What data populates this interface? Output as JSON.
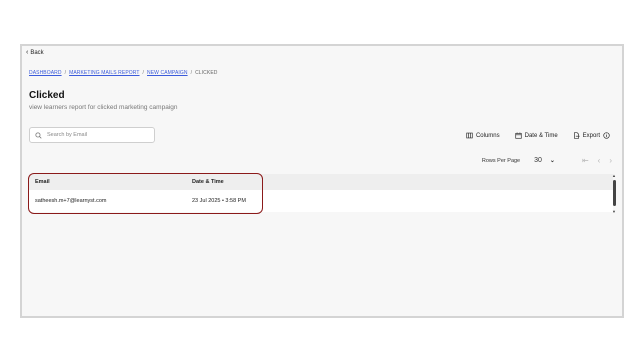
{
  "back": {
    "label": "Back"
  },
  "breadcrumb": {
    "items": [
      "DASHBOARD",
      "MARKETING MAILS REPORT",
      "NEW CAMPAIGN"
    ],
    "separator": "/",
    "current": "CLICKED"
  },
  "page": {
    "title": "Clicked",
    "subtitle": "view learners report for clicked marketing campaign"
  },
  "search": {
    "placeholder": "Search by Email",
    "value": ""
  },
  "toolbar": {
    "columns_label": "Columns",
    "datetime_label": "Date & Time",
    "export_label": "Export"
  },
  "pager": {
    "rows_label": "Rows Per Page",
    "rows_value": "30"
  },
  "table": {
    "columns": [
      "Email",
      "Date & Time"
    ],
    "rows": [
      {
        "email": "satheesh.m+7@learnyst.com",
        "datetime": "23 Jul 2025 • 3:58 PM"
      }
    ]
  },
  "colors": {
    "link": "#3b5bdb",
    "highlight_border": "#8b1a1a",
    "header_bg": "#eeeeee",
    "page_bg": "#f7f7f7"
  }
}
